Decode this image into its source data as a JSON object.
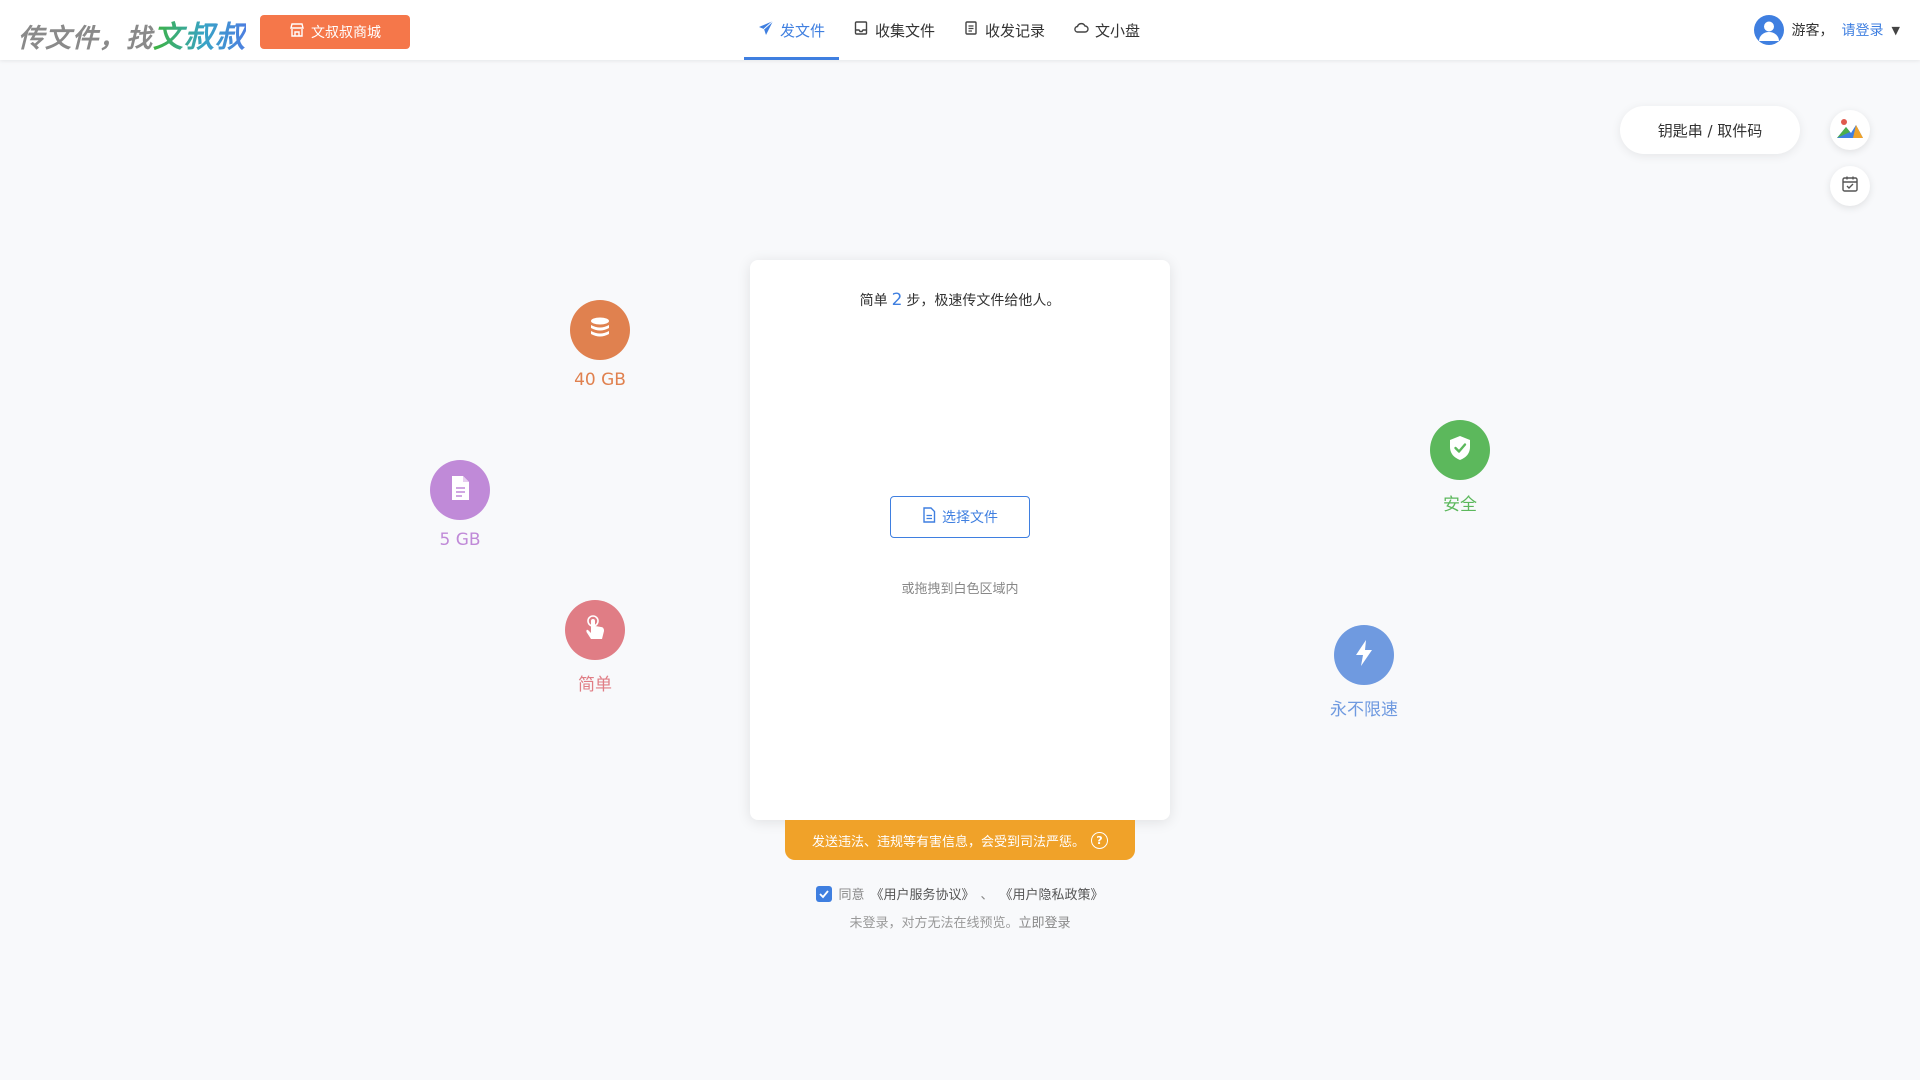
{
  "header": {
    "logo_prefix": "传文件，找",
    "logo_accent": "文叔叔",
    "shop_label": "文叔叔商城",
    "nav": [
      {
        "label": "发文件",
        "active": true
      },
      {
        "label": "收集文件",
        "active": false
      },
      {
        "label": "收发记录",
        "active": false
      },
      {
        "label": "文小盘",
        "active": false
      }
    ],
    "user": {
      "guest_label": "游客，",
      "login_label": "请登录"
    }
  },
  "side": {
    "key_button_label": "钥匙串 / 取件码"
  },
  "features": [
    {
      "label": "40 GB",
      "icon": "database-icon",
      "color": "#e0814f"
    },
    {
      "label": "5 GB",
      "icon": "file-icon",
      "color": "#c08ad8"
    },
    {
      "label": "简单",
      "icon": "pointer-hand-icon",
      "color": "#e07d85"
    },
    {
      "label": "安全",
      "icon": "shield-check-icon",
      "color": "#5cb85c"
    },
    {
      "label": "永不限速",
      "icon": "lightning-icon",
      "color": "#6f9ae0"
    }
  ],
  "card": {
    "title_prefix": "简单",
    "title_num": "2",
    "title_suffix": "步，极速传文件给他人。",
    "choose_label": "选择文件",
    "drag_hint": "或拖拽到白色区域内"
  },
  "warning": {
    "text": "发送违法、违规等有害信息，会受到司法严惩。"
  },
  "agreement": {
    "agree_label": "同意",
    "service_link": "《用户服务协议》",
    "separator": "、",
    "privacy_link": "《用户隐私政策》",
    "login_note_prefix": "未登录，对方无法在线预览。",
    "login_note_link": "立即登录"
  }
}
